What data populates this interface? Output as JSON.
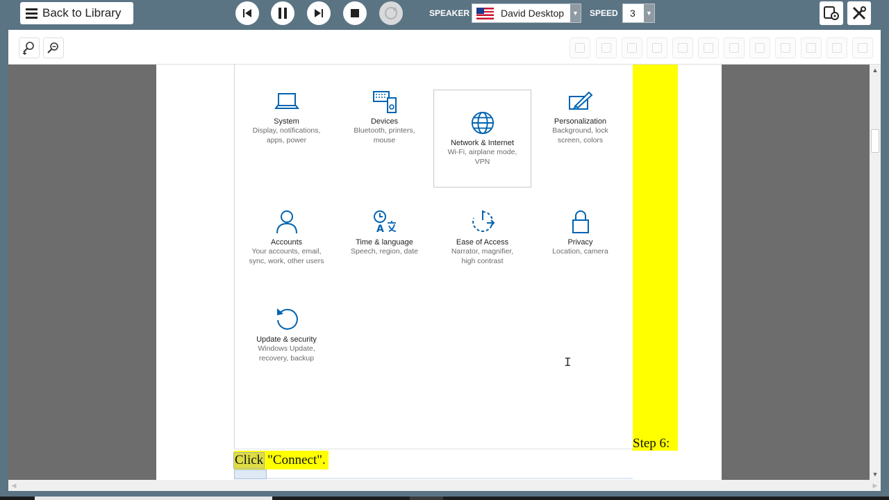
{
  "toolbar": {
    "back_label": "Back to Library",
    "speaker_label": "SPEAKER",
    "speaker_value": "David Desktop",
    "speed_label": "SPEED",
    "speed_value": "3"
  },
  "settings_tiles": [
    {
      "title": "System",
      "desc": "Display, notifications, apps, power",
      "icon": "laptop-icon"
    },
    {
      "title": "Devices",
      "desc": "Bluetooth, printers, mouse",
      "icon": "devices-icon"
    },
    {
      "title": "Network & Internet",
      "desc": "Wi-Fi, airplane mode, VPN",
      "icon": "globe-icon"
    },
    {
      "title": "Personalization",
      "desc": "Background, lock screen, colors",
      "icon": "paintbrush-icon"
    },
    {
      "title": "Accounts",
      "desc": "Your accounts, email, sync, work, other users",
      "icon": "person-icon"
    },
    {
      "title": "Time & language",
      "desc": "Speech, region, date",
      "icon": "time-language-icon"
    },
    {
      "title": "Ease of Access",
      "desc": "Narrator, magnifier, high contrast",
      "icon": "ease-of-access-icon"
    },
    {
      "title": "Privacy",
      "desc": "Location, camera",
      "icon": "lock-icon"
    },
    {
      "title": "Update & security",
      "desc": "Windows Update, recovery, backup",
      "icon": "refresh-icon"
    }
  ],
  "document": {
    "step_label": "Step 6:",
    "click_word": "Click",
    "click_rest": "\"Connect\"."
  },
  "colors": {
    "chrome": "#5b7484",
    "highlight": "#ffff00",
    "accent_blue": "#0063b1"
  }
}
